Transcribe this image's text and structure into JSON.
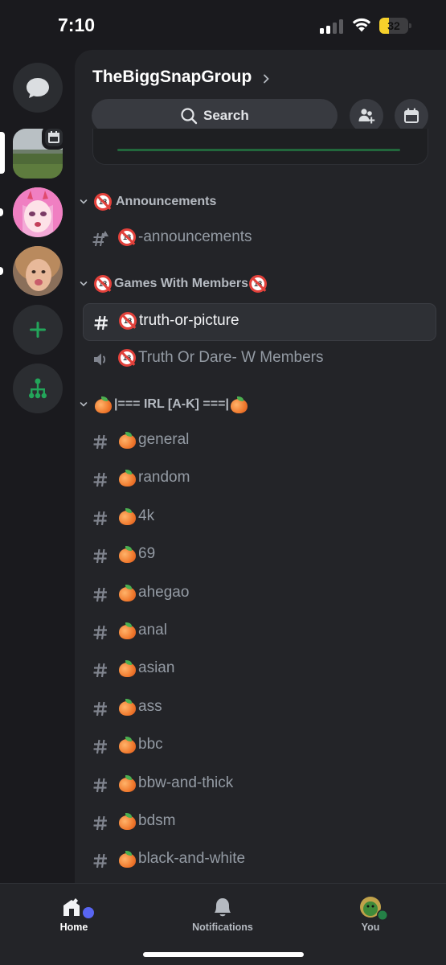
{
  "status_bar": {
    "time": "7:10",
    "battery_percent": "32",
    "battery_level": 0.32,
    "signal_bars": 2
  },
  "server_rail": {
    "items": [
      {
        "name": "direct-messages",
        "icon": "chat-bubble-icon"
      },
      {
        "name": "server-1",
        "icon": "landscape-avatar",
        "selected": true,
        "event_badge": "calendar-icon"
      },
      {
        "name": "server-2",
        "icon": "anime-avatar",
        "unread": true
      },
      {
        "name": "server-3",
        "icon": "photo-avatar",
        "unread": true
      },
      {
        "name": "add-server",
        "icon": "plus-icon"
      },
      {
        "name": "discover",
        "icon": "hub-icon"
      }
    ]
  },
  "guild": {
    "title": "TheBiggSnapGroup",
    "search_label": "Search",
    "invite_icon": "add-member-icon",
    "events_icon": "calendar-icon"
  },
  "categories": [
    {
      "label": "Announcements",
      "prefix_emoji": "no-under-18-emoji",
      "channels": [
        {
          "type": "announcement",
          "icon": "announcement-hash-icon",
          "emoji": "no-under-18-emoji",
          "label": "-announcements"
        }
      ]
    },
    {
      "label": "Games With Members",
      "prefix_emoji": "no-under-18-emoji",
      "suffix_emoji": "no-under-18-emoji",
      "channels": [
        {
          "type": "text",
          "icon": "hash-icon",
          "emoji": "no-under-18-emoji",
          "label": "truth-or-picture",
          "selected": true
        },
        {
          "type": "voice",
          "icon": "speaker-icon",
          "emoji": "no-under-18-emoji",
          "label": "Truth Or Dare- W Members"
        }
      ]
    },
    {
      "label": "|=== IRL [A-K] ===|",
      "prefix_emoji": "peach-emoji",
      "suffix_emoji": "peach-emoji",
      "channels": [
        {
          "type": "text",
          "icon": "hash-icon",
          "emoji": "peach-emoji",
          "label": "general"
        },
        {
          "type": "text",
          "icon": "hash-icon",
          "emoji": "peach-emoji",
          "label": "random"
        },
        {
          "type": "text",
          "icon": "hash-icon",
          "emoji": "peach-emoji",
          "label": "4k"
        },
        {
          "type": "text",
          "icon": "hash-icon",
          "emoji": "peach-emoji",
          "label": "69"
        },
        {
          "type": "text",
          "icon": "hash-icon",
          "emoji": "peach-emoji",
          "label": "ahegao"
        },
        {
          "type": "text",
          "icon": "hash-icon",
          "emoji": "peach-emoji",
          "label": "anal"
        },
        {
          "type": "text",
          "icon": "hash-icon",
          "emoji": "peach-emoji",
          "label": "asian"
        },
        {
          "type": "text",
          "icon": "hash-icon",
          "emoji": "peach-emoji",
          "label": "ass"
        },
        {
          "type": "text",
          "icon": "hash-icon",
          "emoji": "peach-emoji",
          "label": "bbc"
        },
        {
          "type": "text",
          "icon": "hash-icon",
          "emoji": "peach-emoji",
          "label": "bbw-and-thick"
        },
        {
          "type": "text",
          "icon": "hash-icon",
          "emoji": "peach-emoji",
          "label": "bdsm"
        },
        {
          "type": "text",
          "icon": "hash-icon",
          "emoji": "peach-emoji",
          "label": "black-and-white"
        }
      ]
    }
  ],
  "bottom_nav": {
    "home": "Home",
    "notifications": "Notifications",
    "you": "You"
  },
  "colors": {
    "background": "#1a1a1e",
    "panel": "#232428",
    "accent_green": "#23a55a",
    "status_online": "#248046",
    "unread_dot": "#5865f2",
    "battery": "#f5d02b"
  }
}
